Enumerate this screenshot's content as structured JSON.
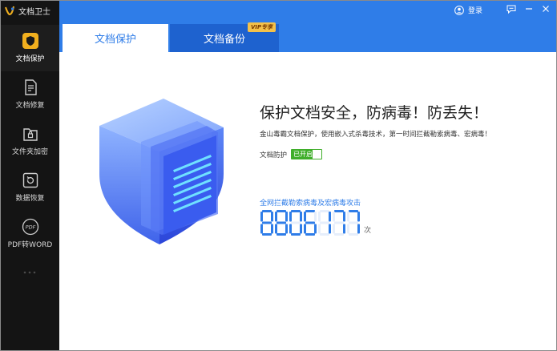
{
  "app": {
    "title": "文档卫士"
  },
  "sidebar": {
    "items": [
      {
        "label": "文档保护",
        "icon": "shield-icon",
        "active": true
      },
      {
        "label": "文档修复",
        "icon": "document-repair-icon"
      },
      {
        "label": "文件夹加密",
        "icon": "folder-lock-icon"
      },
      {
        "label": "数据恢复",
        "icon": "restore-icon"
      },
      {
        "label": "PDF转WORD",
        "icon": "pdf-convert-icon"
      }
    ]
  },
  "topbar": {
    "login_label": "登录",
    "tabs": [
      {
        "label": "文档保护",
        "active": true
      },
      {
        "label": "文档备份",
        "badge": "VIP专享"
      }
    ]
  },
  "main": {
    "headline": "保护文档安全，防病毒！防丢失！",
    "description": "金山毒霸文档保护，使用嵌入式杀毒技术，第一时间拦截勒索病毒、宏病毒！",
    "protection_label": "文档防护",
    "protection_state": "已开启",
    "stat_label": "全网拦截勒索病毒及宏病毒攻击",
    "counter": "8806177",
    "counter_unit": "次"
  },
  "colors": {
    "accent": "#2f7de8",
    "tab_dark": "#1e62cf",
    "sidebar_bg": "#141414",
    "active_icon": "#f2b01e",
    "toggle_on": "#3fae2a"
  }
}
